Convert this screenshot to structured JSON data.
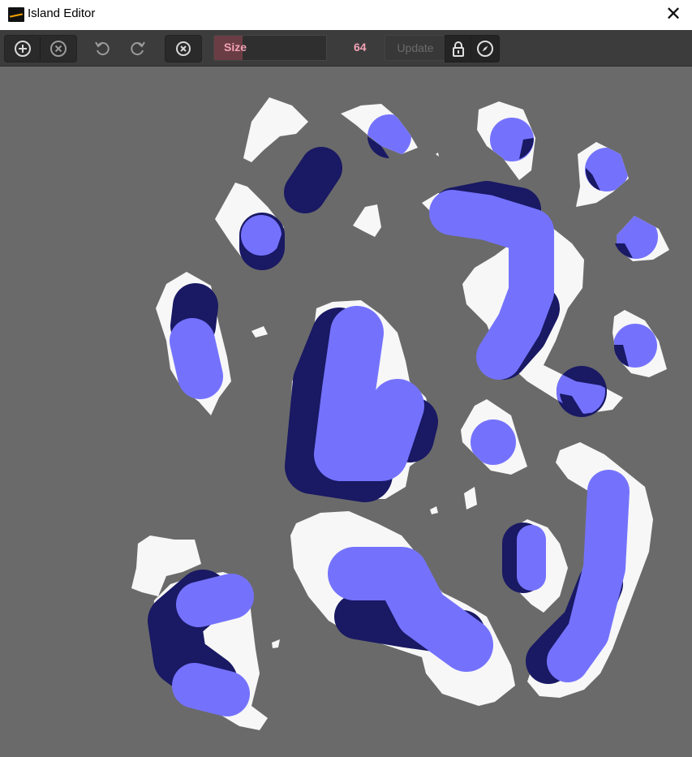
{
  "window": {
    "title": "Island Editor",
    "close_glyph": "✕"
  },
  "toolbar": {
    "tools": [
      {
        "name": "add-icon"
      },
      {
        "name": "remove-icon"
      },
      {
        "name": "undo-icon"
      },
      {
        "name": "redo-icon"
      },
      {
        "name": "clear-icon"
      }
    ],
    "size": {
      "label": "Size",
      "value": "64",
      "fill_fraction": 0.25
    },
    "update_label": "Update",
    "lock_icon": "lock-icon",
    "compass_icon": "compass-icon"
  },
  "colors": {
    "canvas_bg": "#6a6a6a",
    "land": "#f7f7f7",
    "brush_light": "#7472fd",
    "brush_dark": "#191964",
    "accent_pink": "#f3a2b6"
  }
}
